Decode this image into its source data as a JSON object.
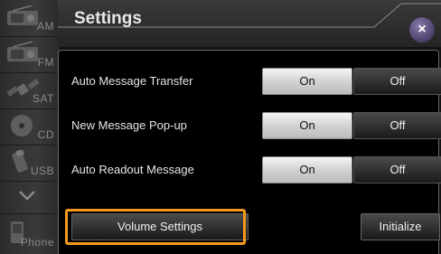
{
  "sidebar": {
    "sources": [
      {
        "label": "AM",
        "icon": "radio-am-icon"
      },
      {
        "label": "FM",
        "icon": "radio-fm-icon"
      },
      {
        "label": "SAT",
        "icon": "satellite-icon"
      },
      {
        "label": "CD",
        "icon": "disc-icon"
      },
      {
        "label": "USB",
        "icon": "usb-icon"
      },
      {
        "label": "",
        "icon": "chevron-down-icon"
      },
      {
        "label": "Phone",
        "icon": "phone-icon"
      }
    ]
  },
  "header": {
    "title": "Settings",
    "close_glyph": "×"
  },
  "settings": [
    {
      "label": "Auto Message Transfer",
      "on_label": "On",
      "off_label": "Off",
      "selected": "On"
    },
    {
      "label": "New Message Pop-up",
      "on_label": "On",
      "off_label": "Off",
      "selected": "On"
    },
    {
      "label": "Auto Readout Message",
      "on_label": "On",
      "off_label": "Off",
      "selected": "On"
    }
  ],
  "footer": {
    "volume_label": "Volume Settings",
    "initialize_label": "Initialize"
  },
  "colors": {
    "highlight": "#f39a1c",
    "close_button": "#5a4a80"
  }
}
